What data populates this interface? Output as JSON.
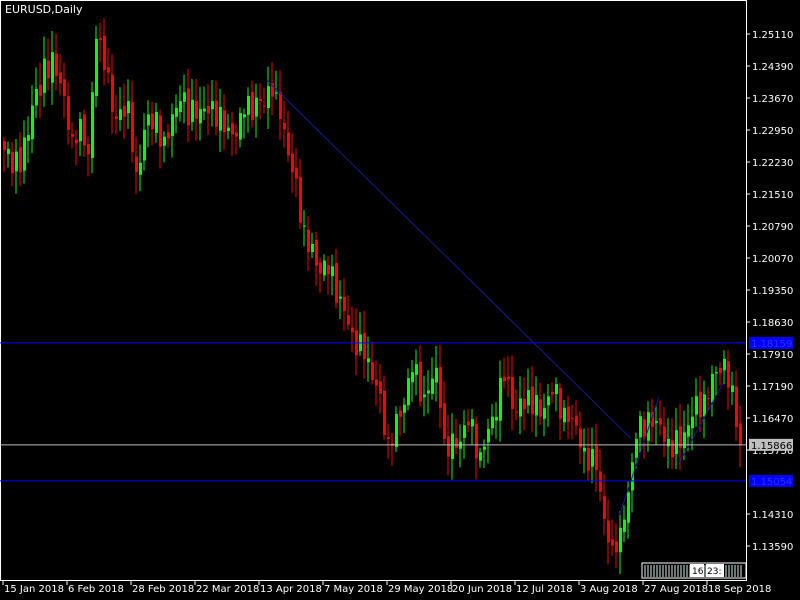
{
  "window": {
    "title": "EURUSD,Daily"
  },
  "colors": {
    "background": "#000000",
    "up": "#00ff00",
    "down": "#ff0000",
    "frame": "#ffffff",
    "level_line": "#0000ff",
    "trend_line": "#1a1a8c",
    "bid_line": "#c0c0c0"
  },
  "chart_data": {
    "type": "candlestick",
    "title": "EURUSD,Daily",
    "ylim": [
      1.132,
      1.2587
    ],
    "y_ticks": [
      "1.25110",
      "1.24390",
      "1.23670",
      "1.22950",
      "1.22230",
      "1.21510",
      "1.20790",
      "1.20070",
      "1.19350",
      "1.18630",
      "1.17910",
      "1.17190",
      "1.16470",
      "1.15750",
      "1.14310",
      "1.13590"
    ],
    "x_ticks": [
      {
        "label": "15 Jan 2018",
        "index": 0
      },
      {
        "label": "6 Feb 2018",
        "index": 16
      },
      {
        "label": "28 Feb 2018",
        "index": 32
      },
      {
        "label": "22 Mar 2018",
        "index": 48
      },
      {
        "label": "13 Apr 2018",
        "index": 64
      },
      {
        "label": "7 May 2018",
        "index": 80
      },
      {
        "label": "29 May 2018",
        "index": 96
      },
      {
        "label": "20 Jun 2018",
        "index": 112
      },
      {
        "label": "12 Jul 2018",
        "index": 128
      },
      {
        "label": "3 Aug 2018",
        "index": 144
      },
      {
        "label": "27 Aug 2018",
        "index": 160
      },
      {
        "label": "18 Sep 2018",
        "index": 176
      }
    ],
    "close_keypoints": [
      [
        0,
        1.225
      ],
      [
        4,
        1.22
      ],
      [
        7,
        1.235
      ],
      [
        12,
        1.247
      ],
      [
        14,
        1.24
      ],
      [
        17,
        1.228
      ],
      [
        19,
        1.232
      ],
      [
        21,
        1.224
      ],
      [
        23,
        1.25
      ],
      [
        25,
        1.243
      ],
      [
        28,
        1.232
      ],
      [
        31,
        1.236
      ],
      [
        33,
        1.22
      ],
      [
        36,
        1.233
      ],
      [
        40,
        1.228
      ],
      [
        44,
        1.236
      ],
      [
        48,
        1.232
      ],
      [
        52,
        1.236
      ],
      [
        55,
        1.229
      ],
      [
        58,
        1.228
      ],
      [
        60,
        1.233
      ],
      [
        64,
        1.236
      ],
      [
        67,
        1.237
      ],
      [
        69,
        1.232
      ],
      [
        72,
        1.22
      ],
      [
        75,
        1.208
      ],
      [
        78,
        1.199
      ],
      [
        81,
        1.197
      ],
      [
        84,
        1.192
      ],
      [
        87,
        1.184
      ],
      [
        90,
        1.178
      ],
      [
        93,
        1.172
      ],
      [
        96,
        1.16
      ],
      [
        99,
        1.165
      ],
      [
        102,
        1.175
      ],
      [
        105,
        1.17
      ],
      [
        108,
        1.176
      ],
      [
        109,
        1.167
      ],
      [
        110,
        1.16
      ],
      [
        113,
        1.158
      ],
      [
        116,
        1.163
      ],
      [
        119,
        1.157
      ],
      [
        122,
        1.165
      ],
      [
        125,
        1.173
      ],
      [
        128,
        1.166
      ],
      [
        131,
        1.171
      ],
      [
        134,
        1.165
      ],
      [
        137,
        1.17
      ],
      [
        140,
        1.167
      ],
      [
        143,
        1.163
      ],
      [
        145,
        1.158
      ],
      [
        148,
        1.153
      ],
      [
        150,
        1.142
      ],
      [
        152,
        1.136
      ],
      [
        154,
        1.14
      ],
      [
        156,
        1.148
      ],
      [
        158,
        1.16
      ],
      [
        161,
        1.166
      ],
      [
        163,
        1.164
      ],
      [
        166,
        1.16
      ],
      [
        169,
        1.158
      ],
      [
        172,
        1.165
      ],
      [
        175,
        1.17
      ],
      [
        178,
        1.175
      ],
      [
        180,
        1.178
      ],
      [
        182,
        1.172
      ],
      [
        184,
        1.15866
      ]
    ],
    "horizontal_levels": [
      {
        "price": 1.18159,
        "label": "1.18159",
        "kind": "level"
      },
      {
        "price": 1.15054,
        "label": "1.15054",
        "kind": "level"
      },
      {
        "price": 1.15866,
        "label": "1.15866",
        "kind": "bid"
      }
    ],
    "trend_lines": [
      {
        "from": [
          66,
          1.2407
        ],
        "to": [
          157,
          1.1601
        ]
      },
      {
        "from": [
          154,
          1.1425
        ],
        "to": [
          164,
          1.1695
        ]
      },
      {
        "from": [
          169,
          1.1545
        ],
        "to": [
          180,
          1.1725
        ]
      }
    ]
  },
  "scroll_box": {
    "labels": [
      "16",
      "23:"
    ]
  }
}
